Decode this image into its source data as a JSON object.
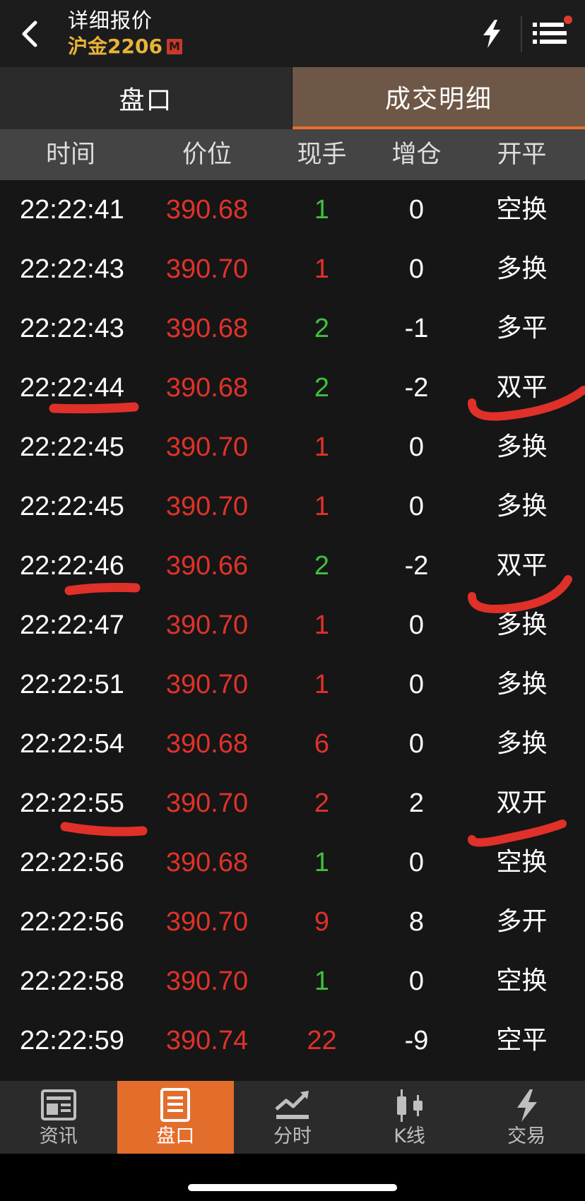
{
  "header": {
    "title": "详细报价",
    "subtitle": "沪金2206",
    "badge": "M",
    "back_icon": "chevron-left-icon",
    "flash_icon": "lightning-icon",
    "menu_icon": "list-menu-icon",
    "notification_dot_color": "#e03a2e"
  },
  "tabs": [
    {
      "label": "盘口",
      "active": false
    },
    {
      "label": "成交明细",
      "active": true
    }
  ],
  "columns": [
    "时间",
    "价位",
    "现手",
    "增仓",
    "开平"
  ],
  "rows": [
    {
      "time": "22:22:41",
      "price": "390.68",
      "vol": "1",
      "vol_dir": "down",
      "oi": "0",
      "type": "空换"
    },
    {
      "time": "22:22:43",
      "price": "390.70",
      "vol": "1",
      "vol_dir": "up",
      "oi": "0",
      "type": "多换"
    },
    {
      "time": "22:22:43",
      "price": "390.68",
      "vol": "2",
      "vol_dir": "down",
      "oi": "-1",
      "type": "多平"
    },
    {
      "time": "22:22:44",
      "price": "390.68",
      "vol": "2",
      "vol_dir": "down",
      "oi": "-2",
      "type": "双平"
    },
    {
      "time": "22:22:45",
      "price": "390.70",
      "vol": "1",
      "vol_dir": "up",
      "oi": "0",
      "type": "多换"
    },
    {
      "time": "22:22:45",
      "price": "390.70",
      "vol": "1",
      "vol_dir": "up",
      "oi": "0",
      "type": "多换"
    },
    {
      "time": "22:22:46",
      "price": "390.66",
      "vol": "2",
      "vol_dir": "down",
      "oi": "-2",
      "type": "双平"
    },
    {
      "time": "22:22:47",
      "price": "390.70",
      "vol": "1",
      "vol_dir": "up",
      "oi": "0",
      "type": "多换"
    },
    {
      "time": "22:22:51",
      "price": "390.70",
      "vol": "1",
      "vol_dir": "up",
      "oi": "0",
      "type": "多换"
    },
    {
      "time": "22:22:54",
      "price": "390.68",
      "vol": "6",
      "vol_dir": "up",
      "oi": "0",
      "type": "多换"
    },
    {
      "time": "22:22:55",
      "price": "390.70",
      "vol": "2",
      "vol_dir": "up",
      "oi": "2",
      "type": "双开"
    },
    {
      "time": "22:22:56",
      "price": "390.68",
      "vol": "1",
      "vol_dir": "down",
      "oi": "0",
      "type": "空换"
    },
    {
      "time": "22:22:56",
      "price": "390.70",
      "vol": "9",
      "vol_dir": "up",
      "oi": "8",
      "type": "多开"
    },
    {
      "time": "22:22:58",
      "price": "390.70",
      "vol": "1",
      "vol_dir": "down",
      "oi": "0",
      "type": "空换"
    },
    {
      "time": "22:22:59",
      "price": "390.74",
      "vol": "22",
      "vol_dir": "up",
      "oi": "-9",
      "type": "空平"
    }
  ],
  "colors": {
    "price": "#e0322a",
    "vol_up": "#e0322a",
    "vol_down": "#3ec13e",
    "accent": "#e36e2c",
    "active_tab": "#6e5746",
    "subtitle": "#e8b33a",
    "annotation": "#e0302a"
  },
  "bottom_nav": [
    {
      "label": "资讯",
      "icon": "news-icon",
      "active": false
    },
    {
      "label": "盘口",
      "icon": "order-book-icon",
      "active": true
    },
    {
      "label": "分时",
      "icon": "trend-line-icon",
      "active": false
    },
    {
      "label": "K线",
      "icon": "candlestick-icon",
      "active": false
    },
    {
      "label": "交易",
      "icon": "lightning-icon",
      "active": false
    }
  ]
}
